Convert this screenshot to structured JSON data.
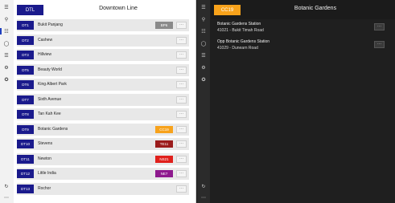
{
  "left": {
    "nav": [
      "menu-icon",
      "search-icon",
      "list-icon",
      "chat-icon",
      "route-icon",
      "settings-icon",
      "pin-icon",
      "refresh-icon",
      "more-icon"
    ],
    "line_badge": "DTL",
    "line_badge_color": "#1a1a8c",
    "line_title": "Downtown Line",
    "stations": [
      {
        "code": "DT1",
        "name": "Bukit Panjang",
        "interchange": "BP6",
        "interchange_color": "#8a8a8a"
      },
      {
        "code": "DT2",
        "name": "Cashew",
        "interchange": "",
        "interchange_color": ""
      },
      {
        "code": "DT3",
        "name": "Hillview",
        "interchange": "",
        "interchange_color": ""
      },
      {
        "code": "DT5",
        "name": "Beauty World",
        "interchange": "",
        "interchange_color": ""
      },
      {
        "code": "DT6",
        "name": "King Albert Park",
        "interchange": "",
        "interchange_color": ""
      },
      {
        "code": "DT7",
        "name": "Sixth Avenue",
        "interchange": "",
        "interchange_color": ""
      },
      {
        "code": "DT8",
        "name": "Tan Kah Kee",
        "interchange": "",
        "interchange_color": ""
      },
      {
        "code": "DT9",
        "name": "Botanic Gardens",
        "interchange": "CC19",
        "interchange_color": "#f7a21b"
      },
      {
        "code": "DT10",
        "name": "Stevens",
        "interchange": "TE11",
        "interchange_color": "#9b1c1c"
      },
      {
        "code": "DT11",
        "name": "Newton",
        "interchange": "NS21",
        "interchange_color": "#e0201b"
      },
      {
        "code": "DT12",
        "name": "Little India",
        "interchange": "NE7",
        "interchange_color": "#8e1a8e"
      },
      {
        "code": "DT13",
        "name": "Rochor",
        "interchange": "",
        "interchange_color": ""
      }
    ],
    "more_label": "···"
  },
  "right": {
    "nav": [
      "menu-icon",
      "search-icon",
      "list-icon",
      "chat-icon",
      "route-icon",
      "settings-icon",
      "pin-icon",
      "refresh-icon",
      "more-icon"
    ],
    "station_badge": "CC19",
    "station_badge_color": "#f7a21b",
    "station_title": "Botanic Gardens",
    "bus_stops": [
      {
        "name": "Botanic Gardens Station",
        "info": "41021 - Bukit Timah Road"
      },
      {
        "name": "Opp Botanic Gardens Station",
        "info": "41029 - Dunearn Road"
      }
    ],
    "more_label": "···"
  }
}
